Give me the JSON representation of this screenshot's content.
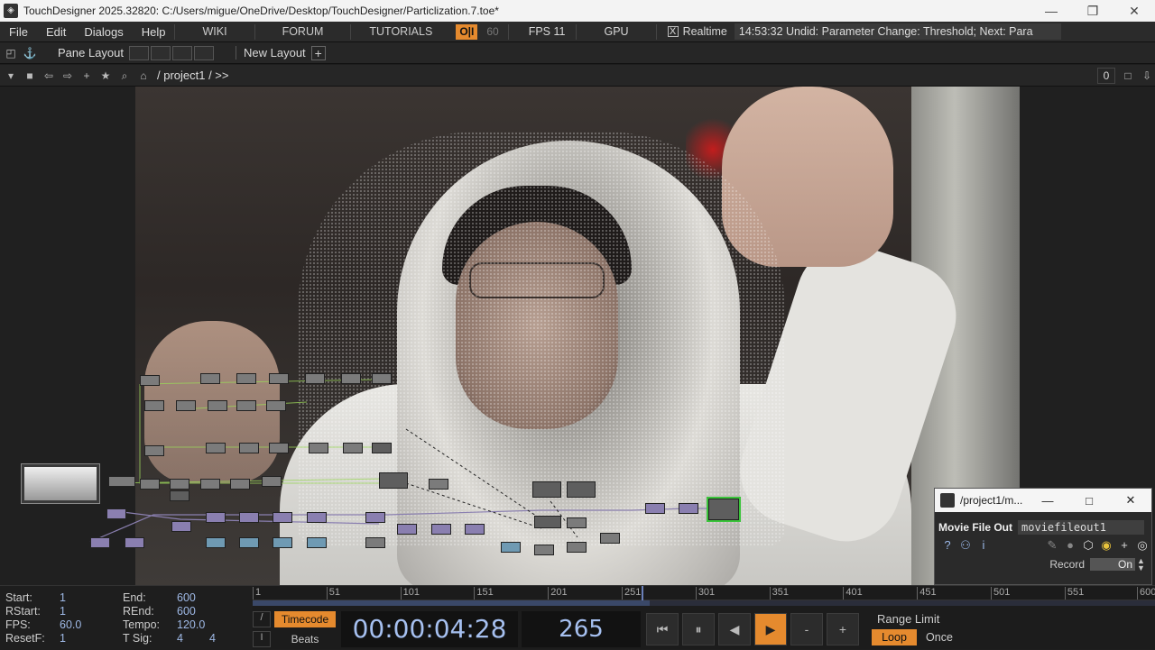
{
  "window": {
    "title": "TouchDesigner 2025.32820: C:/Users/migue/OneDrive/Desktop/TouchDesigner/Particlization.7.toe*",
    "minimize": "—",
    "restore": "❐",
    "close": "✕"
  },
  "menu": {
    "items": [
      "File",
      "Edit",
      "Dialogs",
      "Help"
    ],
    "wiki": "WIKI",
    "forum": "FORUM",
    "tutorials": "TUTORIALS",
    "op_button": "O|I",
    "fps_cap": "60",
    "fps_label": "FPS  11",
    "gpu": "GPU",
    "realtime_check": "X",
    "realtime_label": "Realtime",
    "status": "14:53:32 Undid: Parameter Change: Threshold; Next: Para"
  },
  "panebar": {
    "pane_layout": "Pane Layout",
    "new_layout": "New Layout",
    "add": "+"
  },
  "pathbar": {
    "path": "/ project1 / >>",
    "count": "0"
  },
  "float_window": {
    "title": "/project1/m...",
    "minimize": "—",
    "maximize": "□",
    "close": "✕",
    "op_type": "Movie File Out",
    "op_name": "moviefileout1",
    "record_label": "Record",
    "record_value": "On"
  },
  "timeline": {
    "start_label": "Start:",
    "start_value": "1",
    "rstart_label": "RStart:",
    "rstart_value": "1",
    "fps_label": "FPS:",
    "fps_value": "60.0",
    "resetf_label": "ResetF:",
    "resetf_value": "1",
    "end_label": "End:",
    "end_value": "600",
    "rend_label": "REnd:",
    "rend_value": "600",
    "tempo_label": "Tempo:",
    "tempo_value": "120.0",
    "tsig_label": "T Sig:",
    "tsig_value1": "4",
    "tsig_value2": "4",
    "ruler_ticks": [
      "1",
      "51",
      "101",
      "151",
      "201",
      "251",
      "301",
      "351",
      "401",
      "451",
      "501",
      "551",
      "600"
    ],
    "current_frame_fraction": 0.44,
    "mode_timecode": "Timecode",
    "mode_beats": "Beats",
    "timecode": "00:00:04:28",
    "frame": "265",
    "range_limit": "Range Limit",
    "loop": "Loop",
    "once": "Once",
    "slash_top": "/",
    "slash_bottom": "I"
  },
  "icons": {
    "rewind": "⏮",
    "pause": "⏸",
    "step_back": "◀",
    "play": "▶",
    "minus": "-",
    "plus": "+"
  },
  "colors": {
    "accent_orange": "#e58a2e",
    "timecode_blue": "#a6c0f0",
    "active_node_green": "#3bc43b"
  }
}
